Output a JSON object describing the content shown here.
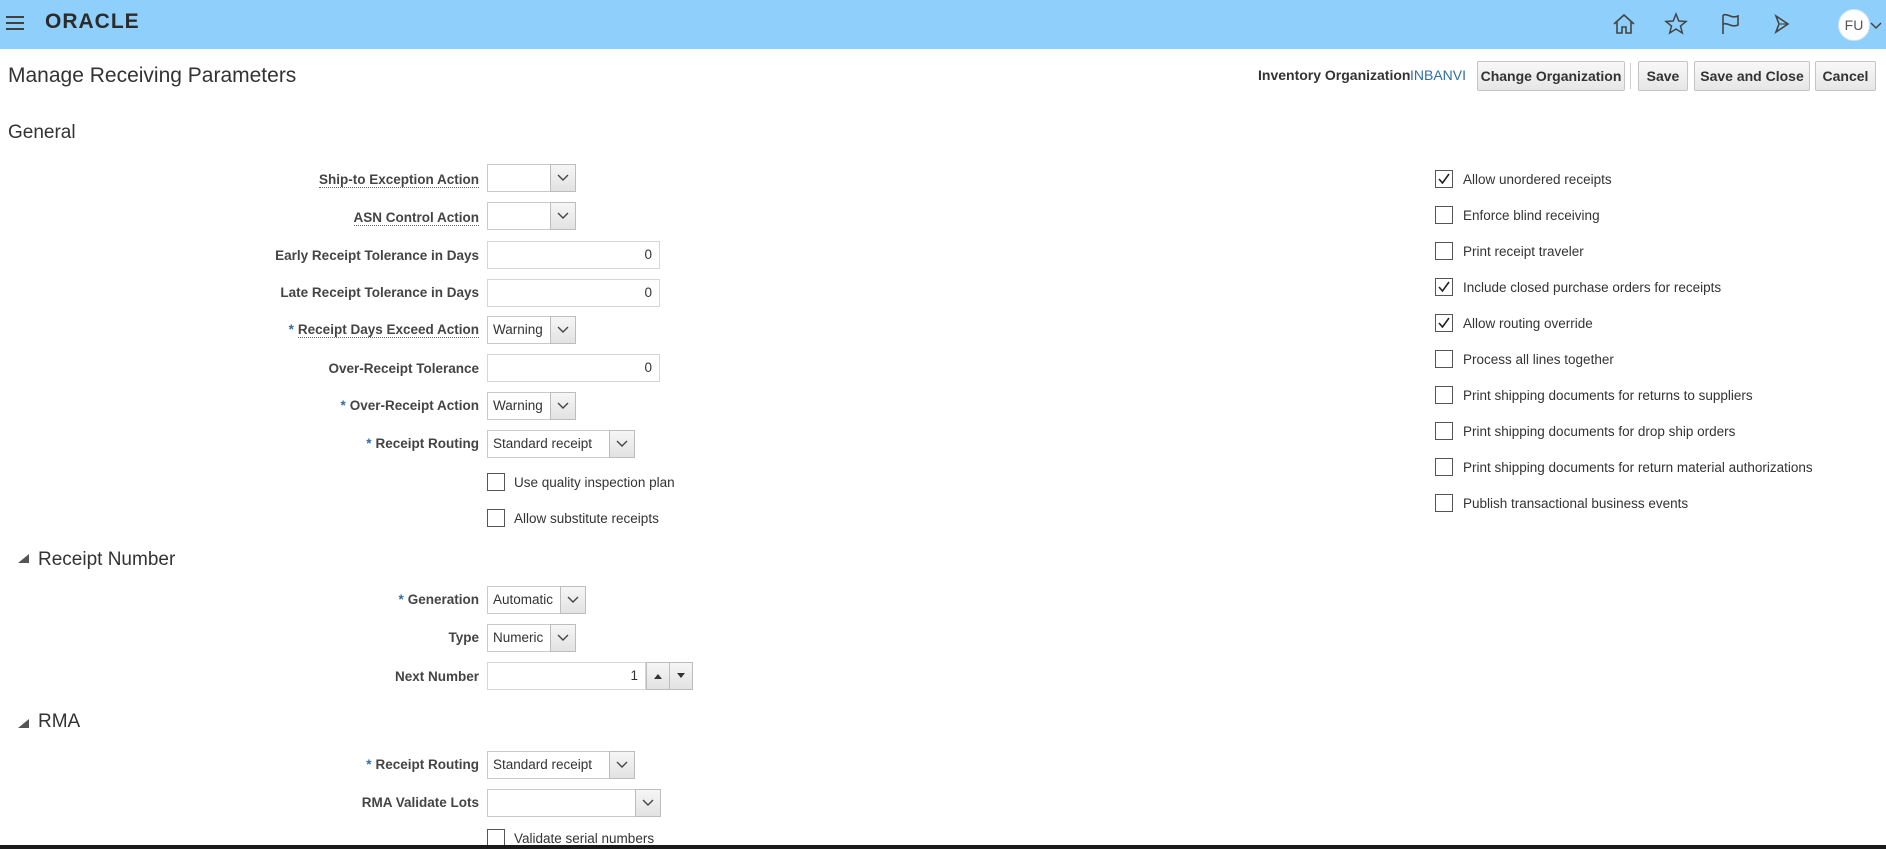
{
  "app": {
    "logo": "ORACLE",
    "user_initials": "FU"
  },
  "icons": {
    "menu": "hamburger-menu-icon",
    "home": "home-icon",
    "favorites": "star-icon",
    "notifications": "flag-icon",
    "watchlist": "bell-icon"
  },
  "colors": {
    "topbar": "#8ed0fb",
    "link": "#2f6ea6",
    "required": "#2f6ea6"
  },
  "header": {
    "title": "Manage Receiving Parameters",
    "org_label": "Inventory Organization",
    "org_value": "INBANVI",
    "change_org_label": "Change Organization",
    "save_label": "Save",
    "save_close_label": "Save and Close",
    "cancel_label": "Cancel"
  },
  "general": {
    "title": "General",
    "fields": {
      "ship_to_exception_action": {
        "label": "Ship-to Exception Action",
        "value": ""
      },
      "asn_control_action": {
        "label": "ASN Control Action",
        "value": ""
      },
      "early_receipt_tolerance": {
        "label": "Early Receipt Tolerance in Days",
        "value": "0"
      },
      "late_receipt_tolerance": {
        "label": "Late Receipt Tolerance in Days",
        "value": "0"
      },
      "receipt_days_exceed_action": {
        "label": "Receipt Days Exceed Action",
        "value": "Warning"
      },
      "over_receipt_tolerance": {
        "label": "Over-Receipt Tolerance",
        "value": "0"
      },
      "over_receipt_action": {
        "label": "Over-Receipt Action",
        "value": "Warning"
      },
      "receipt_routing": {
        "label": "Receipt Routing",
        "value": "Standard receipt"
      }
    },
    "left_checkboxes": [
      {
        "label": "Use quality inspection plan",
        "checked": false
      },
      {
        "label": "Allow substitute receipts",
        "checked": false
      }
    ],
    "right_checkboxes": [
      {
        "label": "Allow unordered receipts",
        "checked": true
      },
      {
        "label": "Enforce blind receiving",
        "checked": false
      },
      {
        "label": "Print receipt traveler",
        "checked": false
      },
      {
        "label": "Include closed purchase orders for receipts",
        "checked": true
      },
      {
        "label": "Allow routing override",
        "checked": true
      },
      {
        "label": "Process all lines together",
        "checked": false
      },
      {
        "label": "Print shipping documents for returns to suppliers",
        "checked": false
      },
      {
        "label": "Print shipping documents for drop ship orders",
        "checked": false
      },
      {
        "label": "Print shipping documents for return material authorizations",
        "checked": false
      },
      {
        "label": "Publish transactional business events",
        "checked": false
      }
    ]
  },
  "receipt_number": {
    "title": "Receipt Number",
    "generation": {
      "label": "Generation",
      "value": "Automatic"
    },
    "type": {
      "label": "Type",
      "value": "Numeric"
    },
    "next_number": {
      "label": "Next Number",
      "value": "1"
    }
  },
  "rma": {
    "title": "RMA",
    "receipt_routing": {
      "label": "Receipt Routing",
      "value": "Standard receipt"
    },
    "validate_lots": {
      "label": "RMA Validate Lots",
      "value": ""
    },
    "validate_serial": {
      "label": "Validate serial numbers",
      "checked": false
    }
  },
  "required_marker": "*"
}
